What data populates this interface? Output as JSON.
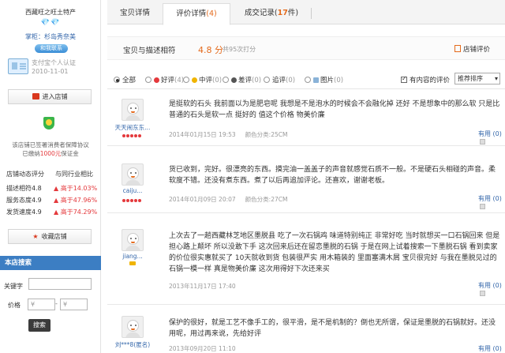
{
  "sidebar": {
    "shop_name": "西藏旺之旺土特产",
    "diamonds": "💎💎",
    "owner_label": "掌柜：",
    "owner_name": "杉岛秀奈美",
    "contact_label": "和我联系",
    "auth_text": "支付宝个人认证",
    "auth_date": "2010-11-01",
    "enter_shop": "进入店铺",
    "guarantee_line1": "该店铺已签署消费者保障协议",
    "guarantee_prefix": "已缴纳",
    "guarantee_amount": "1000元",
    "guarantee_suffix": "保证金",
    "ratings_header_left": "店铺动态评分",
    "ratings_header_right": "与同行业相比",
    "ratings": [
      {
        "label": "描述相符4.8",
        "compare": "▲ 高于14.03%"
      },
      {
        "label": "服务态度4.9",
        "compare": "▲ 高于47.96%"
      },
      {
        "label": "发货速度4.9",
        "compare": "▲ 高于74.29%"
      }
    ],
    "collect_shop": "收藏店铺",
    "search_title": "本店搜索",
    "keyword_label": "关键字",
    "price_label": "价格",
    "price_min_placeholder": "¥",
    "price_max_placeholder": "¥",
    "price_dash": "-",
    "search_button": "搜索"
  },
  "tabs": [
    {
      "label": "宝贝详情"
    },
    {
      "label": "评价详情",
      "count": "(4)"
    },
    {
      "label": "成交记录",
      "count_prefix": "(",
      "count": "17",
      "count_suffix": "件)"
    }
  ],
  "summary": {
    "label": "宝贝与描述相符",
    "score": "4.8 分",
    "count": "共95次打分",
    "shop_rating": "店铺评价"
  },
  "filters": [
    {
      "label": "全部",
      "selected": true
    },
    {
      "label": "好评",
      "count": "(4)",
      "color": "#e4393c"
    },
    {
      "label": "中评",
      "count": "(0)",
      "color": "#f0b400"
    },
    {
      "label": "差评",
      "count": "(0)",
      "color": "#555555"
    },
    {
      "label": "追评",
      "count": "(0)"
    },
    {
      "label": "图片",
      "count": "(0)"
    }
  ],
  "content_only_label": "有内容的评价",
  "sort_label": "推荐排序",
  "reviews": [
    {
      "user": "天天闹东东...",
      "text": "是挺软的石头 我前面以为是肥皂呢 我想是不是泡水的时候会不会融化掉 还好 不是想象中的那么软 只是比普通的石头是软一点 挺好的 值这个价格 物美价廉",
      "date": "2014年01月15日 19:53",
      "sku": "颜色分类:25CM",
      "useful": "有用 (0)"
    },
    {
      "user": "caiju...",
      "text": "货已收到，完好。很漂亮的东西。摸完油一盖盖子的声音就感觉石质不一般。不是硬石头相碰的声音。柔软度不错。还没有煮东西。煮了以后再追加评论。还喜欢，谢谢老板。",
      "date": "2014年01月09日 20:07",
      "sku": "颜色分类:27CM",
      "useful": "有用 (0)"
    },
    {
      "user": "jiang...",
      "text": "上次去了一趟西藏林芝地区墨脱县 吃了一次石锅鸡 味道特别纯正 非常好吃 当时就想买一口石锅回来 但是担心路上颠坏 所以没敢下手 这次回来后还在留恋墨脱的石锅 于是在网上试着搜索一下墨脱石锅 看到卖家的价位很实惠就买了 10天就收到货 包装很严实 用木箱装的 里面塞满木屑 宝贝很完好 与我在墨脱见过的石锅一模一样 真是物美价廉 这次用得好下次还来买",
      "date": "2013年11月17日 17:40",
      "sku": "",
      "useful": "有用 (0)"
    },
    {
      "user": "刘***8(匿名)",
      "text": "保护的很好，就是工艺不像手工的，很平滑，是不是机制的？倒也无所谓，保证是墨脱的石锅就好。还没用呢，用过再来说，先给好评",
      "date": "2013年09月20日 11:10",
      "sku": "",
      "useful": "有用 (0)"
    }
  ]
}
